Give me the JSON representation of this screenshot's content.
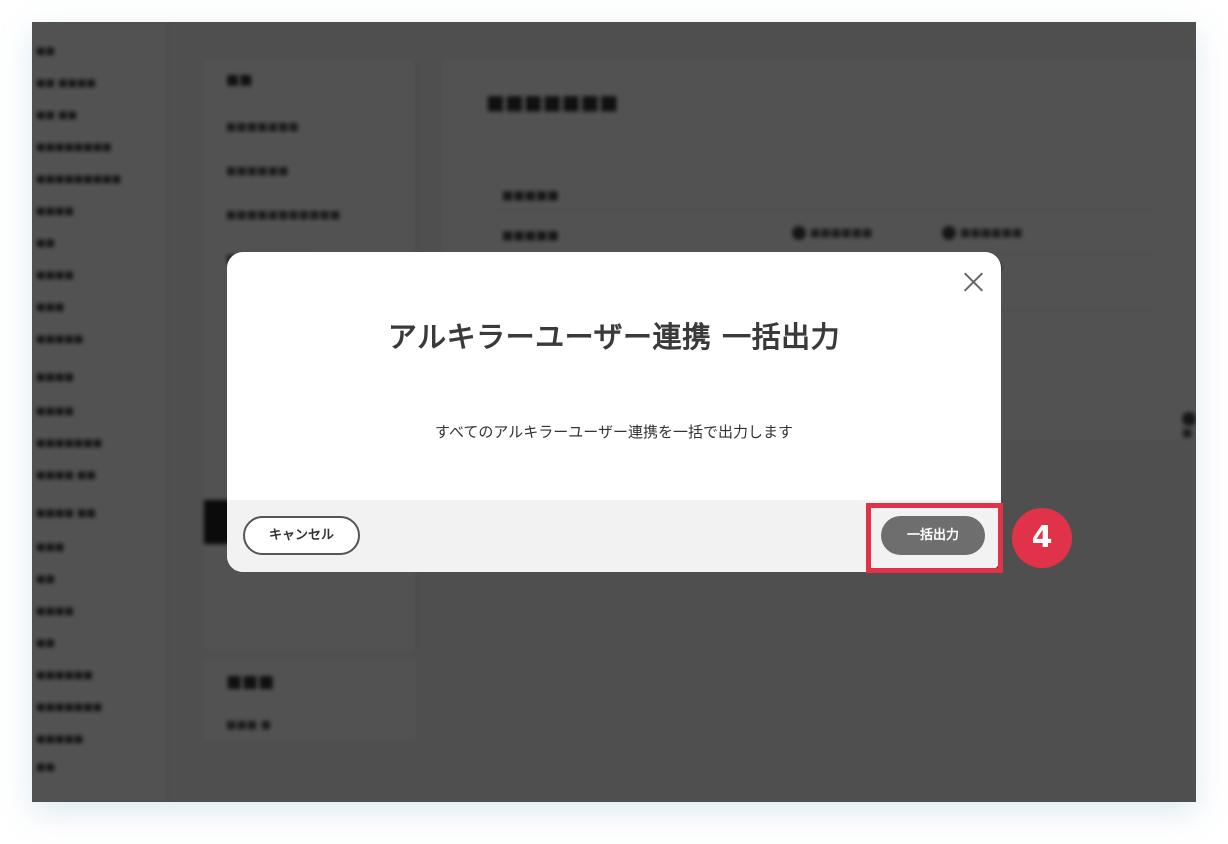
{
  "modal": {
    "title": "アルキラーユーザー連携 一括出力",
    "message": "すべてのアルキラーユーザー連携を一括で出力します",
    "cancel_label": "キャンセル",
    "export_label": "一括出力"
  },
  "annotation": {
    "step_number": "4",
    "color": "#e0334a"
  },
  "colors": {
    "overlay": "#000000",
    "primary_button": "#6e6e6e"
  }
}
